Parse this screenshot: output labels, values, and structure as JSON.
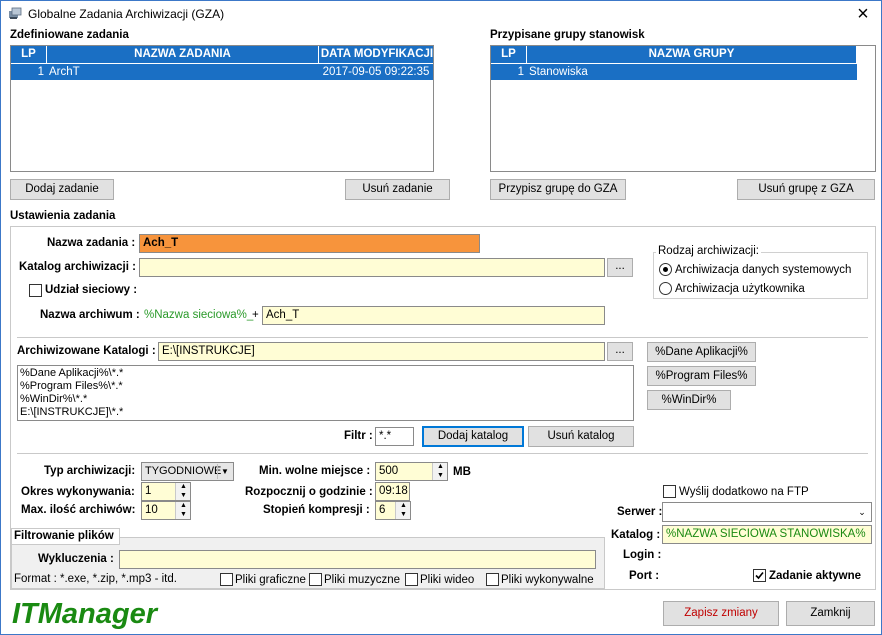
{
  "window": {
    "title": "Globalne Zadania Archiwizacji (GZA)"
  },
  "tasks": {
    "section_title": "Zdefiniowane zadania",
    "columns": [
      "LP",
      "NAZWA ZADANIA",
      "DATA MODYFIKACJI"
    ],
    "rows": [
      {
        "lp": "1",
        "name": "ArchT",
        "date": "2017-09-05 09:22:35"
      }
    ],
    "add_button": "Dodaj zadanie",
    "remove_button": "Usuń zadanie"
  },
  "groups": {
    "section_title": "Przypisane grupy stanowisk",
    "columns": [
      "LP",
      "NAZWA GRUPY"
    ],
    "rows": [
      {
        "lp": "1",
        "name": "Stanowiska"
      }
    ],
    "assign_button": "Przypisz grupę do GZA",
    "remove_button": "Usuń grupę z GZA"
  },
  "settings": {
    "section_title": "Ustawienia zadania",
    "task_name_label": "Nazwa zadania :",
    "task_name_value": "Ach_T",
    "archive_dir_label": "Katalog archiwizacji :",
    "archive_dir_value": "",
    "browse": "...",
    "network_share_label": "Udział sieciowy :",
    "archive_name_label": "Nazwa archiwum :",
    "archive_name_prefix": "%Nazwa sieciowa%_",
    "plus": "+",
    "archive_name_value": "Ach_T",
    "archive_type_group": "Rodzaj archiwizacji:",
    "radio_system": "Archiwizacja danych systemowych",
    "radio_user": "Archiwizacja użytkownika",
    "archived_dirs_label": "Archiwizowane Katalogi :",
    "archived_dirs_value": "E:\\[INSTRUKCJE]",
    "dir_list": [
      "%Dane Aplikacji%\\*.*",
      "%Program Files%\\*.*",
      "%WinDir%\\*.*",
      "E:\\[INSTRUKCJE]\\*.*"
    ],
    "quick_dirs": [
      "%Dane Aplikacji%",
      "%Program Files%",
      "%WinDir%"
    ],
    "filter_label": "Filtr :",
    "filter_value": "*.*",
    "add_dir_button": "Dodaj katalog",
    "remove_dir_button": "Usuń katalog",
    "archive_type_label": "Typ archiwizacji:",
    "archive_type_value": "TYGODNIOWE",
    "period_label": "Okres wykonywania:",
    "period_value": "1",
    "max_archives_label": "Max. ilość archiwów:",
    "max_archives_value": "10",
    "min_free_label": "Min. wolne miejsce :",
    "min_free_value": "500",
    "min_free_unit": "MB",
    "start_time_label": "Rozpocznij o godzinie :",
    "start_time_value": "09:18",
    "compression_label": "Stopień kompresji :",
    "compression_value": "6"
  },
  "file_filter": {
    "group_title": "Filtrowanie plików",
    "exclusions_label": "Wykluczenia :",
    "exclusions_value": "",
    "format_hint": "Format : *.exe, *.zip, *.mp3 - itd.",
    "graphic": "Pliki graficzne",
    "music": "Pliki muzyczne",
    "video": "Pliki wideo",
    "exec": "Pliki wykonywalne"
  },
  "ftp": {
    "send_ftp_label": "Wyślij dodatkowo na FTP",
    "server_label": "Serwer :",
    "server_value": "",
    "dir_label": "Katalog :",
    "dir_value": "%NAZWA SIECIOWA STANOWISKA%",
    "login_label": "Login :",
    "port_label": "Port :",
    "active_label": "Zadanie aktywne"
  },
  "footer": {
    "brand": "ITManager",
    "save_button": "Zapisz zmiany",
    "close_button": "Zamknij"
  },
  "colors": {
    "accent": "#1a6fc4",
    "highlight_input": "#f7943c",
    "input_bg": "#fffdd5",
    "brand": "#1a8a12",
    "save_text": "#c00000"
  }
}
